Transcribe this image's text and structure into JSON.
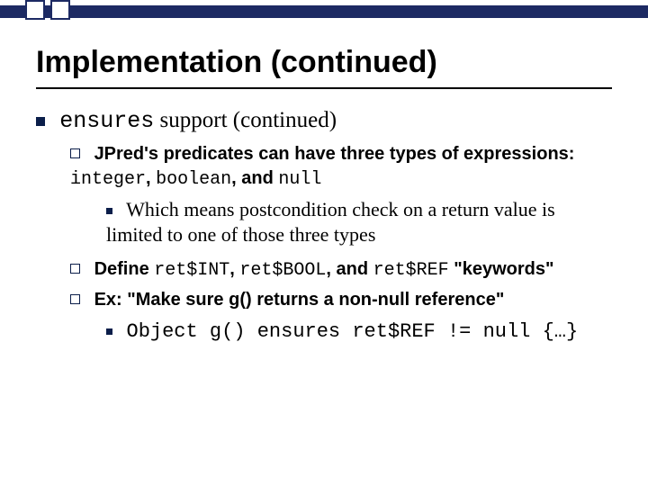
{
  "title": "Implementation (continued)",
  "bullet1": {
    "prefix_code": "ensures",
    "suffix": " support (continued)"
  },
  "sub1": {
    "prefix": "JPred's predicates can have three types of expressions: ",
    "c1": "integer",
    "sep1": ", ",
    "c2": "boolean",
    "sep2": ", and ",
    "c3": "null"
  },
  "sub1a": "Which means postcondition check on a return value is limited to one of those three types",
  "sub2": {
    "prefix": "Define ",
    "c1": "ret$INT",
    "sep1": ", ",
    "c2": "ret$BOOL",
    "sep2": ", and ",
    "c3": "ret$REF",
    "suffix": " \"keywords\""
  },
  "sub3": "Ex: \"Make sure g() returns a non-null reference\"",
  "sub3a": "Object g() ensures ret$REF != null {…}"
}
